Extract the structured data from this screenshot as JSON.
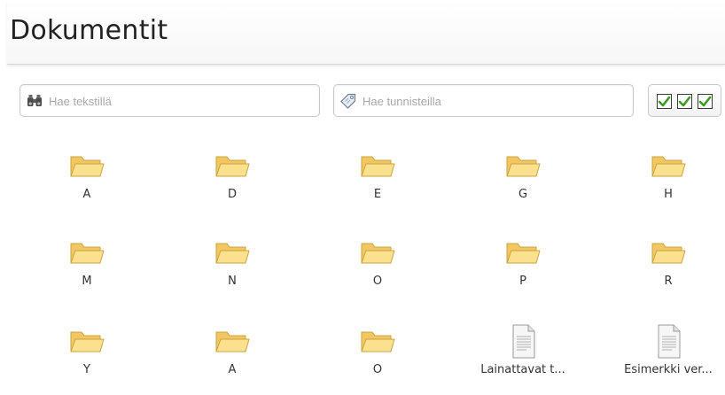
{
  "header": {
    "title": "Dokumentit"
  },
  "search": {
    "text_placeholder": "Hae tekstillä",
    "text_value": "",
    "tags_placeholder": "Hae tunnisteilla",
    "tags_value": ""
  },
  "toolbar": {
    "select_icon": "three-checkboxes-icon"
  },
  "items": [
    {
      "label": "A",
      "type": "folder"
    },
    {
      "label": "D",
      "type": "folder"
    },
    {
      "label": "E",
      "type": "folder"
    },
    {
      "label": "G",
      "type": "folder"
    },
    {
      "label": "H",
      "type": "folder"
    },
    {
      "label": "M",
      "type": "folder"
    },
    {
      "label": "N",
      "type": "folder"
    },
    {
      "label": "O",
      "type": "folder"
    },
    {
      "label": "P",
      "type": "folder"
    },
    {
      "label": "R",
      "type": "folder"
    },
    {
      "label": "Y",
      "type": "folder"
    },
    {
      "label": "Ä",
      "type": "folder"
    },
    {
      "label": "Ö",
      "type": "folder"
    },
    {
      "label": "Lainattavat t...",
      "type": "document"
    },
    {
      "label": "Esimerkki ver...",
      "type": "document"
    }
  ],
  "colors": {
    "folder_fill": "#f9d57a",
    "folder_stroke": "#c9a441",
    "check_green": "#3c9a1e"
  }
}
